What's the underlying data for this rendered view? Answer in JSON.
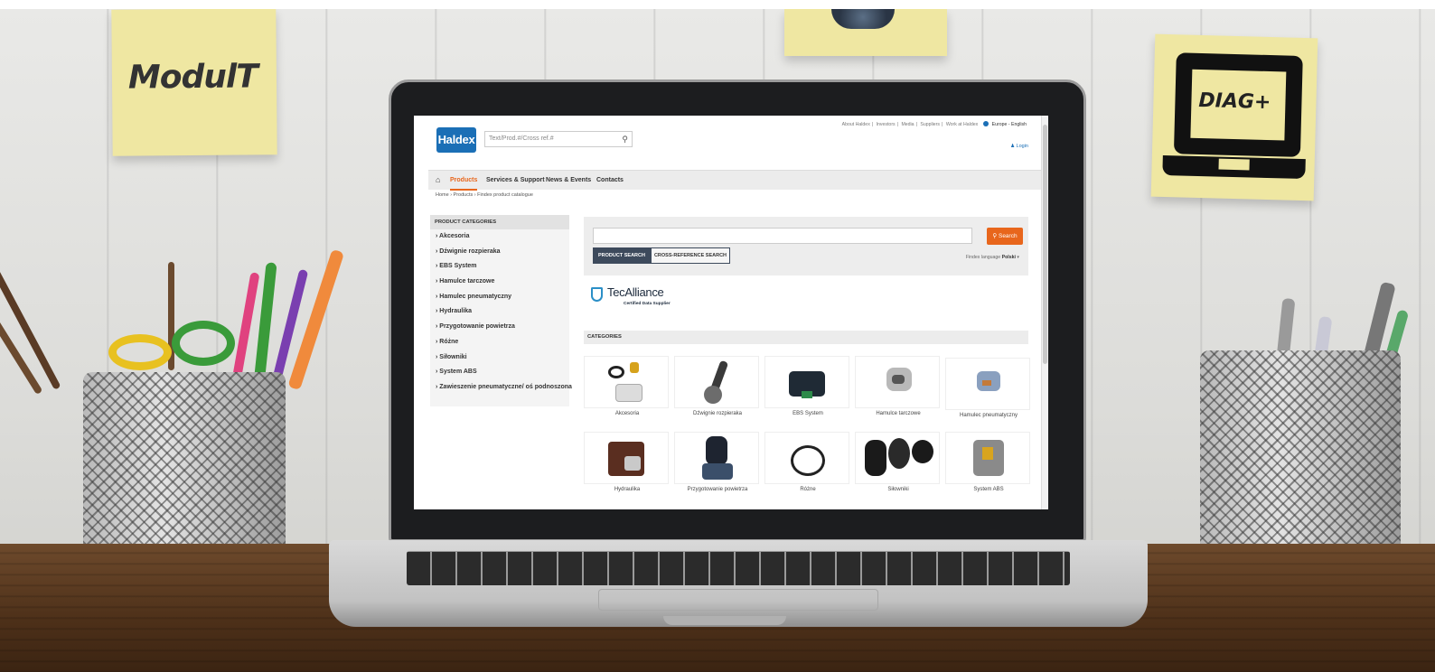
{
  "notes": {
    "left_logo": "ModulT",
    "right_logo": "DIAG+"
  },
  "site": {
    "logo": "Haldex",
    "search_placeholder": "Text/Prod.#/Cross ref.#",
    "top_links": [
      "About Haldex",
      "Investors",
      "Media",
      "Suppliers",
      "Work at Haldex"
    ],
    "region": "Europe - English",
    "login": "Login"
  },
  "nav": {
    "items": [
      "Products",
      "Services & Support",
      "News & Events",
      "Contacts"
    ],
    "active": "Products"
  },
  "breadcrumb": "Home  ›  Products ›  Findex product catalogue",
  "sidebar": {
    "title": "PRODUCT CATEGORIES",
    "items": [
      "› Akcesoria",
      "› Dźwignie rozpieraka",
      "› EBS System",
      "› Hamulce tarczowe",
      "› Hamulec pneumatyczny",
      "› Hydraulika",
      "› Przygotowanie powietrza",
      "› Różne",
      "› Siłowniki",
      "› System ABS",
      "› Zawieszenie pneumatyczne/ oś podnoszona"
    ]
  },
  "search": {
    "button": "Search",
    "tab_product": "PRODUCT SEARCH",
    "tab_cross": "CROSS-REFERENCE SEARCH",
    "language_label": "Findex language",
    "language_value": "Polski"
  },
  "tecalliance": {
    "name": "TecAlliance",
    "tagline": "Certified Data Supplier"
  },
  "categories": {
    "title": "CATEGORIES",
    "tiles": [
      "Akcesoria",
      "Dźwignie rozpieraka",
      "EBS System",
      "Hamulce tarczowe",
      "Hamulec pneumatyczny",
      "Hydraulika",
      "Przygotowanie powietrza",
      "Różne",
      "Siłowniki",
      "System ABS"
    ]
  },
  "colors": {
    "accent": "#e8661c",
    "brand": "#1b6fb6",
    "tab_dark": "#3d4a5c",
    "sticky_note": "#efe7a2"
  },
  "icons": [
    "home-icon",
    "search-icon",
    "globe-icon",
    "user-icon",
    "dropdown-arrow-icon",
    "tecalliance-shield-icon"
  ]
}
